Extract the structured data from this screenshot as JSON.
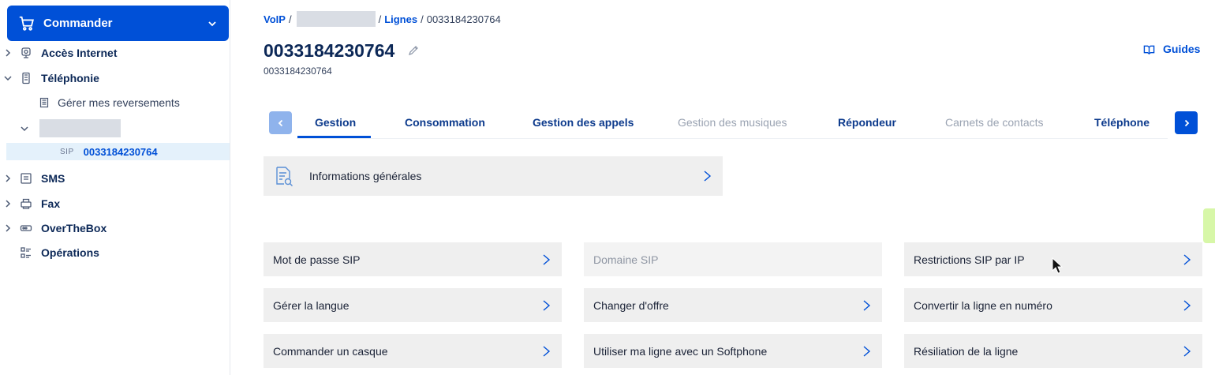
{
  "sidebar": {
    "order_button": "Commander",
    "items": [
      {
        "label": "Accès Internet",
        "icon": "internet-icon"
      },
      {
        "label": "Téléphonie",
        "icon": "phone-icon"
      },
      {
        "label": "SMS",
        "icon": "sms-icon"
      },
      {
        "label": "Fax",
        "icon": "fax-icon"
      },
      {
        "label": "OverTheBox",
        "icon": "overthebox-icon"
      },
      {
        "label": "Opérations",
        "icon": "operations-icon"
      }
    ],
    "sub_reversements": "Gérer mes reversements",
    "selected_type": "SIP",
    "selected_number": "0033184230764"
  },
  "breadcrumb": {
    "voip": "VoIP",
    "lignes": "Lignes",
    "current": "0033184230764"
  },
  "header": {
    "title": "0033184230764",
    "subtitle": "0033184230764",
    "guides": "Guides"
  },
  "tabs": [
    {
      "label": "Gestion",
      "active": true
    },
    {
      "label": "Consommation"
    },
    {
      "label": "Gestion des appels"
    },
    {
      "label": "Gestion des musiques",
      "disabled": true
    },
    {
      "label": "Répondeur"
    },
    {
      "label": "Carnets de contacts",
      "disabled": true
    },
    {
      "label": "Téléphone"
    }
  ],
  "info_tile": "Informations générales",
  "tiles": [
    {
      "label": "Mot de passe SIP"
    },
    {
      "label": "Domaine SIP",
      "disabled": true
    },
    {
      "label": "Restrictions SIP par IP"
    },
    {
      "label": "Gérer la langue"
    },
    {
      "label": "Changer d'offre"
    },
    {
      "label": "Convertir la ligne en numéro"
    },
    {
      "label": "Commander un casque"
    },
    {
      "label": "Utiliser ma ligne avec un Softphone"
    },
    {
      "label": "Résiliation de la ligne"
    }
  ],
  "colors": {
    "accent": "#0050d7",
    "tile_bg": "#efefef",
    "selected_bg": "#e4f1fb"
  }
}
